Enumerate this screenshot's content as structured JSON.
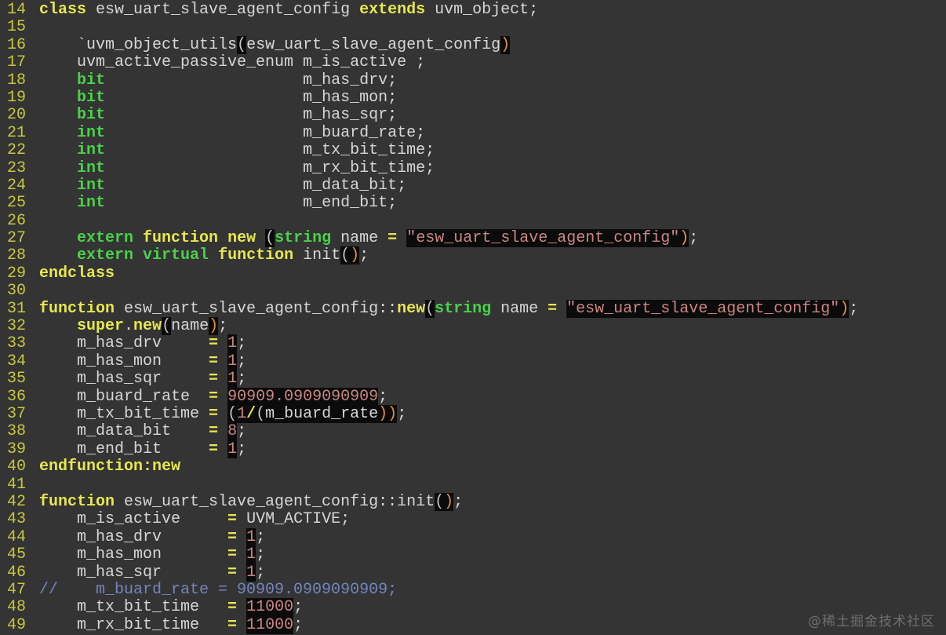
{
  "editor": {
    "language": "systemverilog",
    "colors": {
      "bg": "#343434",
      "blackbox": "#0b0b0b",
      "lineno": "#c8c83c",
      "plain": "#d6d6d6",
      "keyword": "#e7e74f",
      "type": "#4ad14a",
      "string": "#cc8585",
      "paren_open": "#c4c4c4",
      "paren_close": "#e0923c",
      "comment": "#7484bd",
      "watermark": "#6f6f6f"
    },
    "lines": [
      {
        "n": "14",
        "tokens": [
          [
            "kw",
            "class"
          ],
          [
            "pl",
            " esw_uart_slave_agent_config "
          ],
          [
            "kw",
            "extends"
          ],
          [
            "pl",
            " uvm_object;"
          ]
        ]
      },
      {
        "n": "15",
        "tokens": []
      },
      {
        "n": "16",
        "tokens": [
          [
            "pl",
            "    `uvm_object_utils"
          ],
          [
            "po",
            "("
          ],
          [
            "pl",
            "esw_uart_slave_agent_config"
          ],
          [
            "pc",
            ")"
          ]
        ]
      },
      {
        "n": "17",
        "tokens": [
          [
            "pl",
            "    uvm_active_passive_enum m_is_active ;"
          ]
        ]
      },
      {
        "n": "18",
        "tokens": [
          [
            "pl",
            "    "
          ],
          [
            "kw2",
            "bit"
          ],
          [
            "pl",
            "                     m_has_drv;"
          ]
        ]
      },
      {
        "n": "19",
        "tokens": [
          [
            "pl",
            "    "
          ],
          [
            "kw2",
            "bit"
          ],
          [
            "pl",
            "                     m_has_mon;"
          ]
        ]
      },
      {
        "n": "20",
        "tokens": [
          [
            "pl",
            "    "
          ],
          [
            "kw2",
            "bit"
          ],
          [
            "pl",
            "                     m_has_sqr;"
          ]
        ]
      },
      {
        "n": "21",
        "tokens": [
          [
            "pl",
            "    "
          ],
          [
            "kw2",
            "int"
          ],
          [
            "pl",
            "                     m_buard_rate;"
          ]
        ]
      },
      {
        "n": "22",
        "tokens": [
          [
            "pl",
            "    "
          ],
          [
            "kw2",
            "int"
          ],
          [
            "pl",
            "                     m_tx_bit_time;"
          ]
        ]
      },
      {
        "n": "23",
        "tokens": [
          [
            "pl",
            "    "
          ],
          [
            "kw2",
            "int"
          ],
          [
            "pl",
            "                     m_rx_bit_time;"
          ]
        ]
      },
      {
        "n": "24",
        "tokens": [
          [
            "pl",
            "    "
          ],
          [
            "kw2",
            "int"
          ],
          [
            "pl",
            "                     m_data_bit;"
          ]
        ]
      },
      {
        "n": "25",
        "tokens": [
          [
            "pl",
            "    "
          ],
          [
            "kw2",
            "int"
          ],
          [
            "pl",
            "                     m_end_bit;"
          ]
        ]
      },
      {
        "n": "26",
        "tokens": []
      },
      {
        "n": "27",
        "tokens": [
          [
            "pl",
            "    "
          ],
          [
            "kw2",
            "extern"
          ],
          [
            "pl",
            " "
          ],
          [
            "kw",
            "function"
          ],
          [
            "pl",
            " "
          ],
          [
            "kw",
            "new"
          ],
          [
            "pl",
            " "
          ],
          [
            "po",
            "("
          ],
          [
            "kw2",
            "string"
          ],
          [
            "pl",
            " name "
          ],
          [
            "kw",
            "="
          ],
          [
            "pl",
            " "
          ],
          [
            "str",
            "\"esw_uart_slave_agent_config\""
          ],
          [
            "pc",
            ")"
          ],
          [
            "pl",
            ";"
          ]
        ]
      },
      {
        "n": "28",
        "tokens": [
          [
            "pl",
            "    "
          ],
          [
            "kw2",
            "extern"
          ],
          [
            "pl",
            " "
          ],
          [
            "kw2",
            "virtual"
          ],
          [
            "pl",
            " "
          ],
          [
            "kw",
            "function"
          ],
          [
            "pl",
            " init"
          ],
          [
            "po",
            "("
          ],
          [
            "pc",
            ")"
          ],
          [
            "pl",
            ";"
          ]
        ]
      },
      {
        "n": "29",
        "tokens": [
          [
            "kw",
            "endclass"
          ]
        ]
      },
      {
        "n": "30",
        "tokens": []
      },
      {
        "n": "31",
        "tokens": [
          [
            "kw",
            "function"
          ],
          [
            "pl",
            " esw_uart_slave_agent_config::"
          ],
          [
            "kw",
            "new"
          ],
          [
            "po",
            "("
          ],
          [
            "kw2",
            "string"
          ],
          [
            "pl",
            " name "
          ],
          [
            "kw",
            "="
          ],
          [
            "pl",
            " "
          ],
          [
            "str",
            "\"esw_uart_slave_agent_config\""
          ],
          [
            "pc",
            ")"
          ],
          [
            "pl",
            ";"
          ]
        ]
      },
      {
        "n": "32",
        "tokens": [
          [
            "pl",
            "    "
          ],
          [
            "kw",
            "super"
          ],
          [
            "pl",
            "."
          ],
          [
            "kw",
            "new"
          ],
          [
            "po",
            "("
          ],
          [
            "pl",
            "name"
          ],
          [
            "pc",
            ")"
          ],
          [
            "pl",
            ";"
          ]
        ]
      },
      {
        "n": "33",
        "tokens": [
          [
            "pl",
            "    m_has_drv     "
          ],
          [
            "kw",
            "="
          ],
          [
            "pl",
            " "
          ],
          [
            "num",
            "1"
          ],
          [
            "pl",
            ";"
          ]
        ]
      },
      {
        "n": "34",
        "tokens": [
          [
            "pl",
            "    m_has_mon     "
          ],
          [
            "kw",
            "="
          ],
          [
            "pl",
            " "
          ],
          [
            "num",
            "1"
          ],
          [
            "pl",
            ";"
          ]
        ]
      },
      {
        "n": "35",
        "tokens": [
          [
            "pl",
            "    m_has_sqr     "
          ],
          [
            "kw",
            "="
          ],
          [
            "pl",
            " "
          ],
          [
            "num",
            "1"
          ],
          [
            "pl",
            ";"
          ]
        ]
      },
      {
        "n": "36",
        "tokens": [
          [
            "pl",
            "    m_buard_rate  "
          ],
          [
            "kw",
            "="
          ],
          [
            "pl",
            " "
          ],
          [
            "num",
            "90909.0909090909"
          ],
          [
            "pl",
            ";"
          ]
        ]
      },
      {
        "n": "37",
        "tokens": [
          [
            "pl",
            "    m_tx_bit_time "
          ],
          [
            "kw",
            "="
          ],
          [
            "pl",
            " "
          ],
          [
            "po",
            "("
          ],
          [
            "num",
            "1"
          ],
          [
            "kwb",
            "/"
          ],
          [
            "po",
            "("
          ],
          [
            "plb",
            "m_buard_rate"
          ],
          [
            "pc",
            "))"
          ],
          [
            "pl",
            ";"
          ]
        ]
      },
      {
        "n": "38",
        "tokens": [
          [
            "pl",
            "    m_data_bit    "
          ],
          [
            "kw",
            "="
          ],
          [
            "pl",
            " "
          ],
          [
            "num",
            "8"
          ],
          [
            "pl",
            ";"
          ]
        ]
      },
      {
        "n": "39",
        "tokens": [
          [
            "pl",
            "    m_end_bit     "
          ],
          [
            "kw",
            "="
          ],
          [
            "pl",
            " "
          ],
          [
            "num",
            "1"
          ],
          [
            "pl",
            ";"
          ]
        ]
      },
      {
        "n": "40",
        "tokens": [
          [
            "kw",
            "endfunction:new"
          ]
        ]
      },
      {
        "n": "41",
        "tokens": []
      },
      {
        "n": "42",
        "tokens": [
          [
            "kw",
            "function"
          ],
          [
            "pl",
            " esw_uart_slave_agent_config::init"
          ],
          [
            "po",
            "("
          ],
          [
            "pc",
            ")"
          ],
          [
            "pl",
            ";"
          ]
        ]
      },
      {
        "n": "43",
        "tokens": [
          [
            "pl",
            "    m_is_active     "
          ],
          [
            "kw",
            "="
          ],
          [
            "pl",
            " UVM_ACTIVE;"
          ]
        ]
      },
      {
        "n": "44",
        "tokens": [
          [
            "pl",
            "    m_has_drv       "
          ],
          [
            "kw",
            "="
          ],
          [
            "pl",
            " "
          ],
          [
            "num",
            "1"
          ],
          [
            "pl",
            ";"
          ]
        ]
      },
      {
        "n": "45",
        "tokens": [
          [
            "pl",
            "    m_has_mon       "
          ],
          [
            "kw",
            "="
          ],
          [
            "pl",
            " "
          ],
          [
            "num",
            "1"
          ],
          [
            "pl",
            ";"
          ]
        ]
      },
      {
        "n": "46",
        "tokens": [
          [
            "pl",
            "    m_has_sqr       "
          ],
          [
            "kw",
            "="
          ],
          [
            "pl",
            " "
          ],
          [
            "num",
            "1"
          ],
          [
            "pl",
            ";"
          ]
        ]
      },
      {
        "n": "47",
        "tokens": [
          [
            "cm",
            "//    m_buard_rate = 90909.0909090909;"
          ]
        ]
      },
      {
        "n": "48",
        "tokens": [
          [
            "pl",
            "    m_tx_bit_time   "
          ],
          [
            "kw",
            "="
          ],
          [
            "pl",
            " "
          ],
          [
            "num",
            "11000"
          ],
          [
            "pl",
            ";"
          ]
        ]
      },
      {
        "n": "49",
        "tokens": [
          [
            "pl",
            "    m_rx_bit_time   "
          ],
          [
            "kw",
            "="
          ],
          [
            "pl",
            " "
          ],
          [
            "num",
            "11000"
          ],
          [
            "pl",
            ";"
          ]
        ]
      }
    ]
  },
  "watermark": "@稀土掘金技术社区"
}
